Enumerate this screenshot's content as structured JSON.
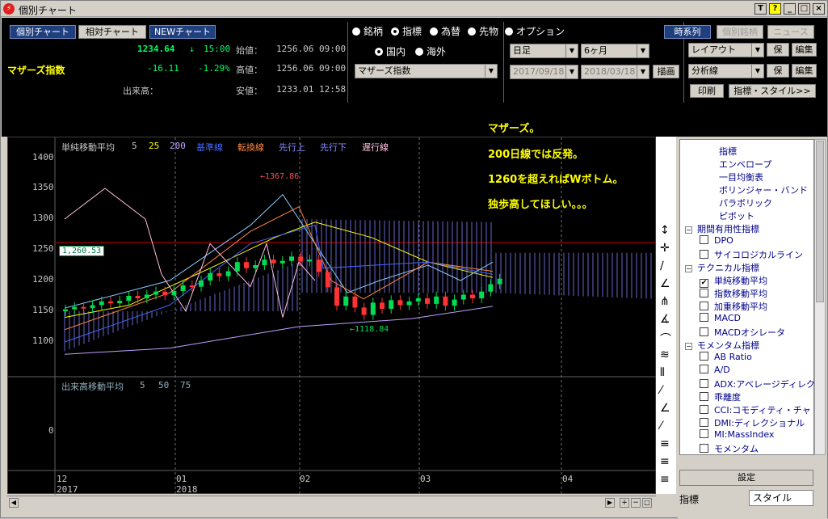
{
  "window": {
    "title": "個別チャート"
  },
  "title_buttons": [
    "T",
    "?",
    "_",
    "□",
    "×"
  ],
  "tabs": {
    "individual": "個別チャート",
    "relative": "相対チャート",
    "new": "NEWチャート"
  },
  "quote": {
    "name": "マザーズ指数",
    "price": "1234.64",
    "arrow": "↓",
    "time": "15:00",
    "change": "-16.11",
    "change_pct": "-1.29%",
    "volume_label": "出来高：",
    "open_label": "始値：",
    "open_value": "1256.06 09:00",
    "high_label": "高値：",
    "high_value": "1256.06 09:00",
    "low_label": "安値：",
    "low_value": "1233.01 12:58"
  },
  "asset_radios": [
    "銘柄",
    "指標",
    "為替",
    "先物",
    "オプション"
  ],
  "region_radios": [
    "国内",
    "海外"
  ],
  "index_select": "マザーズ指数",
  "period_select": "日足",
  "range_select": "6ヶ月",
  "date_from": "2017/09/18",
  "date_to": "2018/03/18",
  "draw_button": "描画",
  "right_buttons": {
    "timeseries": "時系列",
    "indiv_stock": "個別銘柄",
    "news": "ニュース",
    "layout": "レイアウト",
    "save1": "保存",
    "edit1": "編集",
    "analysis": "分析線",
    "save2": "保存",
    "edit2": "編集",
    "print": "印刷",
    "style": "指標・スタイル>>"
  },
  "legend": {
    "sma": "単純移動平均",
    "p5": "5",
    "p25": "25",
    "p200": "200",
    "kijun": "基準線",
    "tenkan": "転換線",
    "senko_up": "先行上",
    "senko_down": "先行下",
    "chikou": "遅行線",
    "vol_ma": "出来高移動平均",
    "v5": "5",
    "v50": "50",
    "v75": "75"
  },
  "annotation": [
    "マザーズ。",
    "200日線では反発。",
    "1260を超えればWボトム。",
    "独歩高してほしい。。。"
  ],
  "marker": {
    "current": "1,260.53",
    "high": "←1367.86",
    "low": "←1118.84"
  },
  "y_axis": [
    "1400",
    "1350",
    "1300",
    "1250",
    "1200",
    "1150",
    "1100"
  ],
  "vol_axis": [
    "0"
  ],
  "x_axis_months": [
    "12",
    "01",
    "02",
    "03",
    "04"
  ],
  "x_axis_years": [
    "2017",
    "2018"
  ],
  "tree": {
    "top_items": [
      "指標",
      "エンベロープ",
      "一目均衡表",
      "ボリンジャー・バンド",
      "パラボリック",
      "ピボット"
    ],
    "group1": "期間有用性指標",
    "group1_items": [
      "DPO",
      "サイコロジカルライン"
    ],
    "group2": "テクニカル指標",
    "group2_items": [
      "単純移動平均",
      "指数移動平均",
      "加重移動平均",
      "MACD",
      "MACDオシレータ"
    ],
    "group3": "モメンタム指標",
    "group3_items": [
      "AB Ratio",
      "A/D",
      "ADX:アベレージディレク",
      "乖離度",
      "CCI:コモディティ・チャ",
      "DMI:ディレクショナル",
      "MI:MassIndex",
      "モメンタム"
    ]
  },
  "settings_button": "設定",
  "bottom_tabs": {
    "indicator": "指標",
    "style": "スタイル"
  },
  "colors": {
    "price_up": "#00cc44",
    "price_down": "#ff3333",
    "accent_yellow": "#ffff00"
  }
}
